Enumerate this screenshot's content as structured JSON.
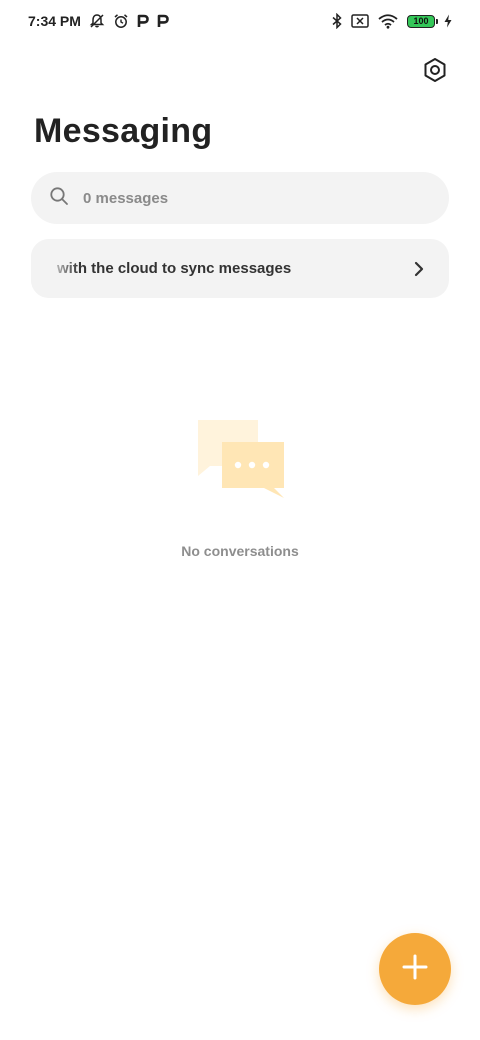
{
  "status_bar": {
    "time": "7:34 PM",
    "battery_level": "100",
    "left_icons": [
      "notifications-off-icon",
      "alarm-icon",
      "parking-p-icon",
      "parking-p-icon"
    ],
    "right_icons": [
      "bluetooth-icon",
      "no-sim-icon",
      "wifi-icon",
      "battery-icon",
      "charging-icon"
    ]
  },
  "header": {
    "title": "Messaging",
    "settings_icon": "settings-hex-icon"
  },
  "search": {
    "placeholder": "0 messages",
    "icon": "search-icon"
  },
  "sync_banner": {
    "text": "with the cloud to sync messages",
    "icon": "chevron-right-icon"
  },
  "empty_state": {
    "illustration": "chat-bubbles-icon",
    "message": "No conversations"
  },
  "fab": {
    "icon": "plus-icon"
  },
  "colors": {
    "accent": "#f5a93a",
    "surface": "#f3f3f3",
    "battery": "#34c759",
    "illustration_light": "#fff3dc",
    "illustration_dark": "#ffe6b5"
  }
}
